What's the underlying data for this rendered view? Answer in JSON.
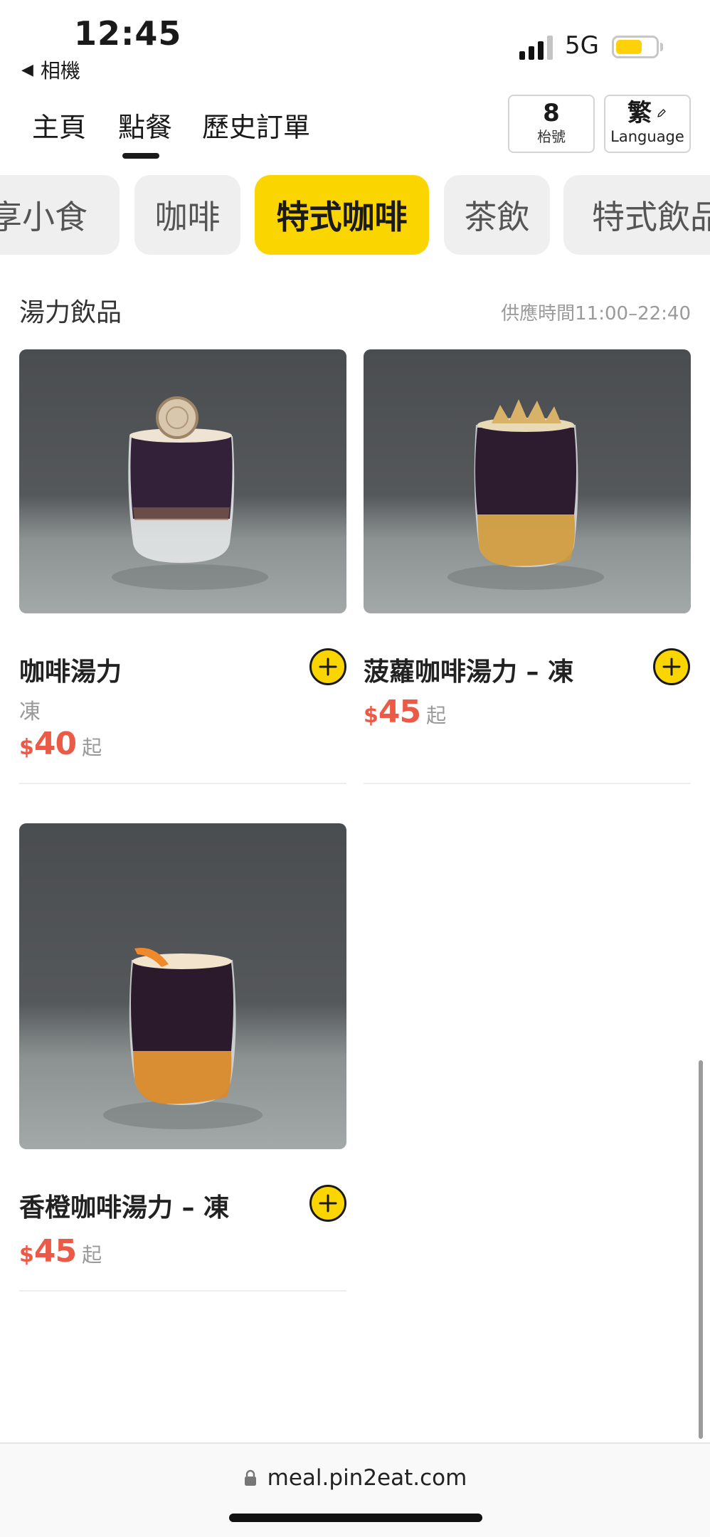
{
  "status": {
    "time": "12:45",
    "back_app": "相機",
    "network": "5G",
    "battery_level": 0.66
  },
  "nav": {
    "tabs": [
      "主頁",
      "點餐",
      "歷史訂單"
    ],
    "active_tab": "點餐"
  },
  "table": {
    "number": "8",
    "label": "枱號"
  },
  "language": {
    "current": "繁",
    "label": "Language"
  },
  "categories": {
    "items": [
      "享小食",
      "咖啡",
      "特式咖啡",
      "茶飲",
      "特式飲品"
    ],
    "active": "特式咖啡"
  },
  "section": {
    "title": "湯力飲品",
    "service_time": "供應時間11:00–22:40"
  },
  "products": [
    {
      "name": "咖啡湯力",
      "subtitle": "凍",
      "currency": "$",
      "price": "40",
      "suffix": "起"
    },
    {
      "name": "菠蘿咖啡湯力 – 凍",
      "currency": "$",
      "price": "45",
      "suffix": "起"
    },
    {
      "name": "香橙咖啡湯力 – 凍",
      "currency": "$",
      "price": "45",
      "suffix": "起"
    }
  ],
  "browser": {
    "url": "meal.pin2eat.com"
  },
  "colors": {
    "accent": "#fbd500",
    "price": "#ea5a47",
    "chip_bg": "#efefef",
    "chip_text": "#555555"
  }
}
